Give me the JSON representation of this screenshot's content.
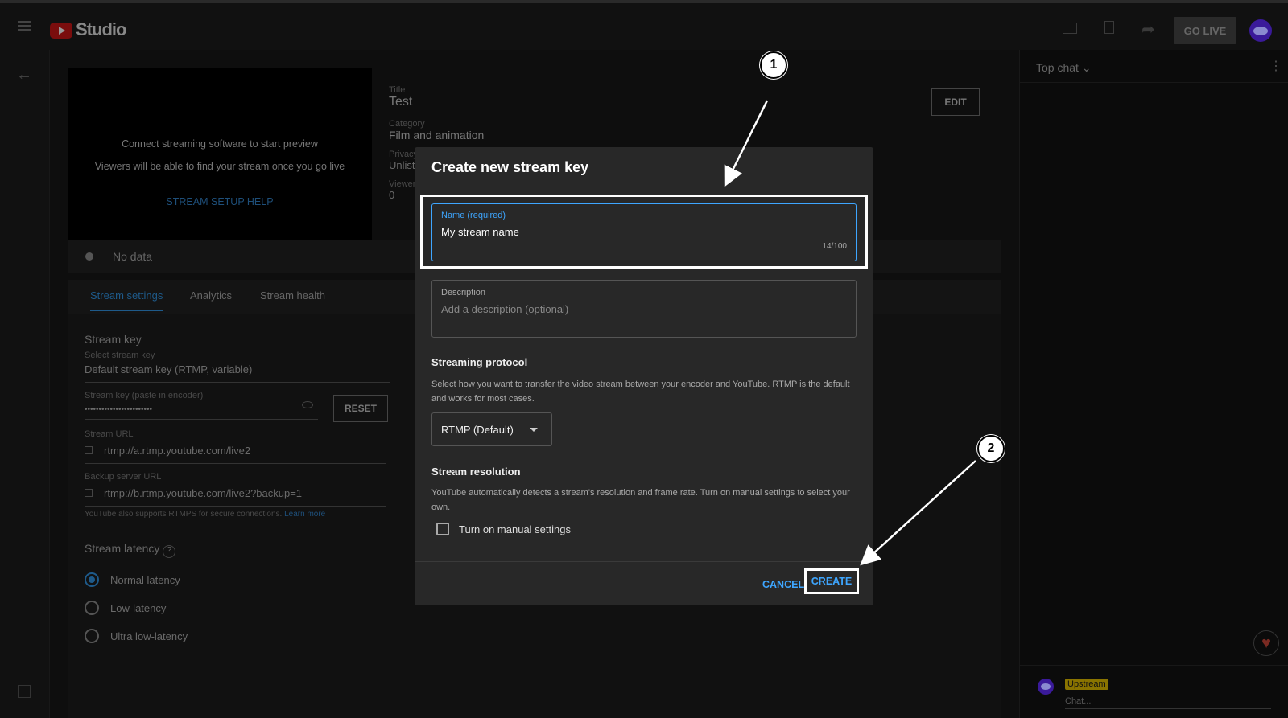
{
  "header": {
    "app_name": "Studio",
    "go_live": "GO LIVE"
  },
  "preview": {
    "line1": "Connect streaming software to start preview",
    "line2": "Viewers will be able to find your stream once you go live",
    "help": "STREAM SETUP HELP",
    "status": "No data"
  },
  "details": {
    "title_label": "Title",
    "title": "Test",
    "category_label": "Category",
    "category": "Film and animation",
    "privacy_label": "Privacy",
    "privacy": "Unlisted",
    "viewers_label": "Viewers",
    "viewers": "0",
    "edit": "EDIT"
  },
  "tabs": [
    "Stream settings",
    "Analytics",
    "Stream health"
  ],
  "settings": {
    "stream_key_heading": "Stream key",
    "select_label": "Select stream key",
    "select_value": "Default stream key (RTMP, variable)",
    "key_label": "Stream key (paste in encoder)",
    "key_value": "••••••••••••••••••••••••",
    "reset": "RESET",
    "url_label": "Stream URL",
    "url": "rtmp://a.rtmp.youtube.com/live2",
    "backup_label": "Backup server URL",
    "backup": "rtmp://b.rtmp.youtube.com/live2?backup=1",
    "rtmps_note": "YouTube also supports RTMPS for secure connections.",
    "learn_more": "Learn more",
    "latency_heading": "Stream latency",
    "latency_options": [
      "Normal latency",
      "Low-latency",
      "Ultra low-latency"
    ],
    "latency_selected": "Normal latency"
  },
  "chat": {
    "mode": "Top chat",
    "badge": "Upstream",
    "placeholder": "Chat..."
  },
  "dialog": {
    "title": "Create new stream key",
    "name_label": "Name (required)",
    "name_value": "My stream name",
    "name_counter": "14/100",
    "desc_label": "Description",
    "desc_placeholder": "Add a description (optional)",
    "protocol_heading": "Streaming protocol",
    "protocol_text": "Select how you want to transfer the video stream between your encoder and YouTube. RTMP is the default and works for most cases.",
    "protocol_value": "RTMP (Default)",
    "resolution_heading": "Stream resolution",
    "resolution_text": "YouTube automatically detects a stream's resolution and frame rate. Turn on manual settings to select your own.",
    "manual_label": "Turn on manual settings",
    "cancel": "CANCEL",
    "create": "CREATE"
  },
  "annotations": [
    "1",
    "2"
  ],
  "colors": {
    "accent": "#3ea6ff",
    "badge": "#8a7400"
  }
}
